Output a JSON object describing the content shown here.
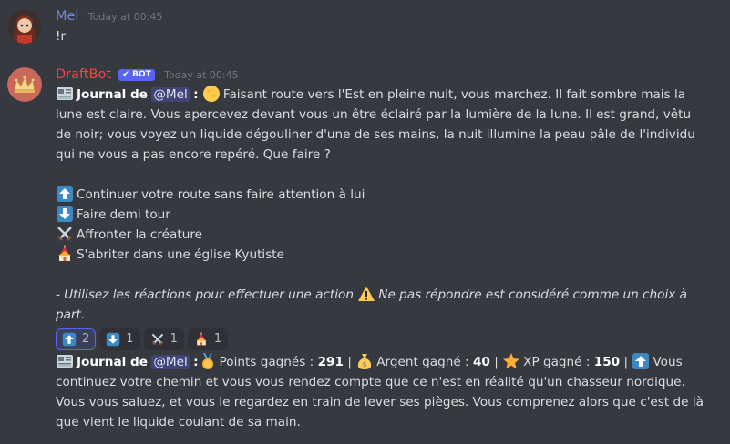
{
  "messages": [
    {
      "author": "Mel",
      "author_color": "#7289da",
      "timestamp": "Today at 00:45",
      "text": "!r"
    },
    {
      "author": "DraftBot",
      "author_color": "#f04747",
      "badge": "BOT",
      "timestamp": "Today at 00:45",
      "journal": {
        "title": "Journal de",
        "mention": "@Mel",
        "colon": ":",
        "para": "Faisant route vers l'Est en pleine nuit, vous marchez. Il fait sombre mais la lune est claire. Vous apercevez devant vous un être éclairé par la lumière de la lune. Il est grand, vêtu de noir; vous voyez un liquide dégouliner d'une de ses mains, la nuit illumine la peau pâle de l'individu qui ne vous a pas encore repéré. Que faire ?"
      },
      "choices": [
        {
          "icon": "arrow-up-icon",
          "label": "Continuer votre route sans faire attention à lui"
        },
        {
          "icon": "arrow-down-icon",
          "label": "Faire demi tour"
        },
        {
          "icon": "crossed-swords-icon",
          "label": "Affronter la créature"
        },
        {
          "icon": "shrine-icon",
          "label": "S'abriter dans une église Kyutiste"
        }
      ],
      "footer_note_a": "- Utilisez les réactions pour effectuer une action",
      "footer_note_b": "Ne pas répondre est considéré comme un choix à part.",
      "reactions": [
        {
          "icon": "arrow-up-icon",
          "count": "2"
        },
        {
          "icon": "arrow-down-icon",
          "count": "1"
        },
        {
          "icon": "crossed-swords-icon",
          "count": "1"
        },
        {
          "icon": "shrine-icon",
          "count": "1"
        }
      ],
      "result": {
        "title": "Journal de",
        "mention": "@Mel",
        "colon": ":",
        "points_label": "Points gagnés :",
        "points_value": "291",
        "sep": "|",
        "money_label": "Argent gagné :",
        "money_value": "40",
        "xp_label": "XP gagné :",
        "xp_value": "150",
        "text_a": "Vous",
        "text_b": "continuez votre chemin et vous vous rendez compte que ce n'est en réalité qu'un chasseur nordique. Vous vous saluez, et vous le regardez en train de lever ses pièges. Vous comprenez alors que c'est de là que vient le liquide coulant de sa main."
      }
    }
  ]
}
